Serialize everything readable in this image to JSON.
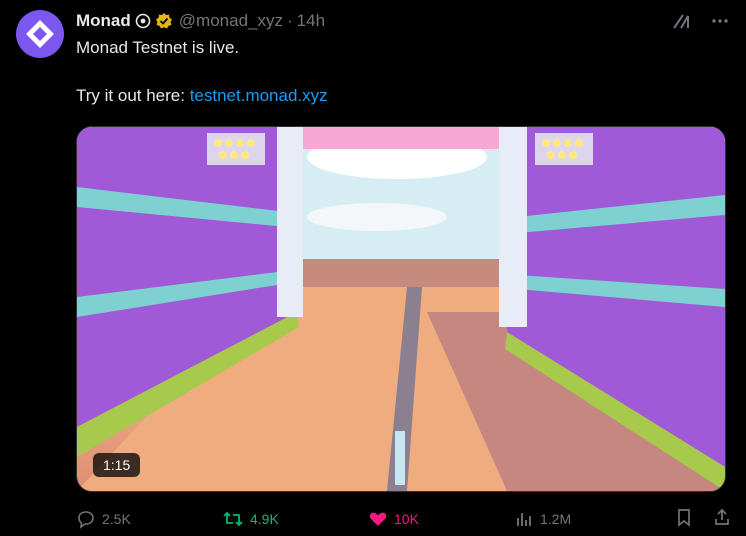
{
  "post": {
    "author_name": "Monad",
    "handle": "@monad_xyz",
    "time": "14h",
    "line1": "Monad Testnet is live.",
    "line2_prefix": "Try it out here: ",
    "link_text": "testnet.monad.xyz"
  },
  "media": {
    "duration": "1:15"
  },
  "actions": {
    "replies": "2.5K",
    "reposts": "4.9K",
    "likes": "10K",
    "views": "1.2M"
  },
  "colors": {
    "background": "#000000",
    "text": "#e7e9ea",
    "muted": "#71767b",
    "link": "#1d9bf0",
    "repost_green": "#00ba7c",
    "like_pink": "#f91880",
    "avatar_purple": "#7b57f0",
    "verified_gold": "#e2b719"
  },
  "icons": [
    "monad-logo-icon",
    "verified-badge-icon",
    "grok-icon",
    "more-icon",
    "reply-icon",
    "repost-icon",
    "like-icon",
    "views-icon",
    "bookmark-icon",
    "share-icon"
  ]
}
